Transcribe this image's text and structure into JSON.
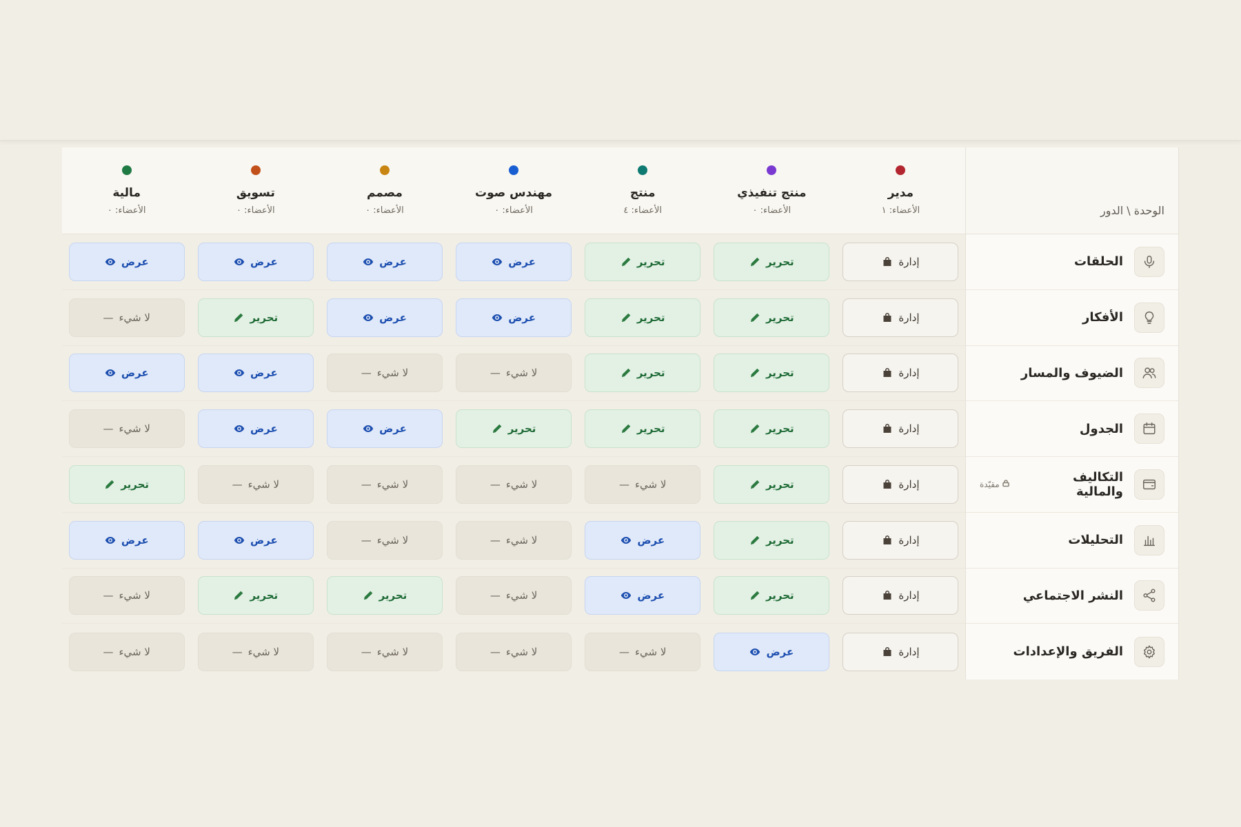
{
  "colors": {
    "manager": "#b3262f",
    "executive_producer": "#7a3ad2",
    "producer": "#0f7a72",
    "sound_engineer": "#1a5fd1",
    "designer": "#c98511",
    "marketing": "#c2501a",
    "finance": "#1f7a44"
  },
  "header": {
    "corner_label": "الوحدة \\ الدور"
  },
  "roles": [
    {
      "key": "manager",
      "name": "مدير",
      "count": "الأعضاء: ١"
    },
    {
      "key": "executive_producer",
      "name": "منتج تنفيذي",
      "count": "الأعضاء: ٠"
    },
    {
      "key": "producer",
      "name": "منتج",
      "count": "الأعضاء: ٤"
    },
    {
      "key": "sound_engineer",
      "name": "مهندس صوت",
      "count": "الأعضاء: ٠"
    },
    {
      "key": "designer",
      "name": "مصمم",
      "count": "الأعضاء: ٠"
    },
    {
      "key": "marketing",
      "name": "تسويق",
      "count": "الأعضاء: ٠"
    },
    {
      "key": "finance",
      "name": "مالية",
      "count": "الأعضاء: ٠"
    }
  ],
  "permission_labels": {
    "manage": "إدارة",
    "edit": "تحرير",
    "view": "عرض",
    "none": "لا شيء"
  },
  "units": [
    {
      "key": "episodes",
      "label": "الحلقات",
      "icon": "microphone-icon",
      "badge": "",
      "perms": [
        "manage",
        "edit",
        "edit",
        "view",
        "view",
        "view",
        "view"
      ]
    },
    {
      "key": "ideas",
      "label": "الأفكار",
      "icon": "lightbulb-icon",
      "badge": "",
      "perms": [
        "manage",
        "edit",
        "edit",
        "view",
        "view",
        "edit",
        "none"
      ]
    },
    {
      "key": "guests",
      "label": "الضيوف والمسار",
      "icon": "users-icon",
      "badge": "",
      "perms": [
        "manage",
        "edit",
        "edit",
        "none",
        "none",
        "view",
        "view"
      ]
    },
    {
      "key": "schedule",
      "label": "الجدول",
      "icon": "calendar-icon",
      "badge": "",
      "perms": [
        "manage",
        "edit",
        "edit",
        "edit",
        "view",
        "view",
        "none"
      ]
    },
    {
      "key": "costs",
      "label": "التكاليف والمالية",
      "icon": "wallet-icon",
      "badge": "مقيّدة",
      "perms": [
        "manage",
        "edit",
        "none",
        "none",
        "none",
        "none",
        "edit"
      ]
    },
    {
      "key": "analytics",
      "label": "التحليلات",
      "icon": "bar-chart-icon",
      "badge": "",
      "perms": [
        "manage",
        "edit",
        "view",
        "none",
        "none",
        "view",
        "view"
      ]
    },
    {
      "key": "social",
      "label": "النشر الاجتماعي",
      "icon": "share-icon",
      "badge": "",
      "perms": [
        "manage",
        "edit",
        "view",
        "none",
        "edit",
        "edit",
        "none"
      ]
    },
    {
      "key": "team",
      "label": "الفريق والإعدادات",
      "icon": "gear-icon",
      "badge": "",
      "perms": [
        "manage",
        "view",
        "none",
        "none",
        "none",
        "none",
        "none"
      ]
    }
  ]
}
